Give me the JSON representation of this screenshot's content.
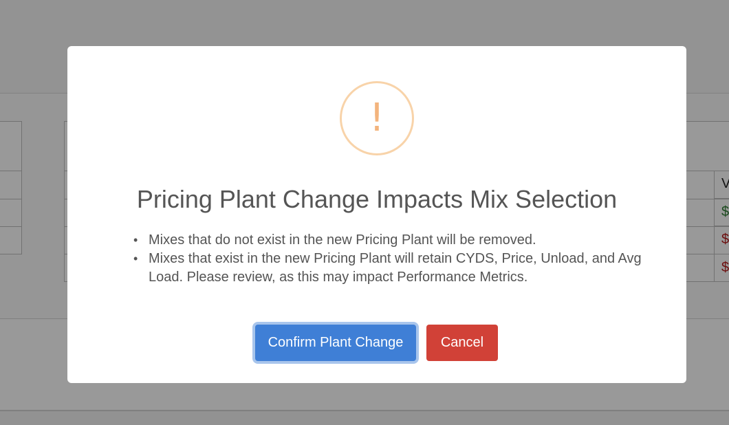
{
  "background": {
    "last_column": {
      "header": "V",
      "cells": [
        {
          "text": "$",
          "tone": "green"
        },
        {
          "text": "$",
          "tone": "red"
        },
        {
          "text": "$",
          "tone": "red"
        }
      ]
    }
  },
  "modal": {
    "icon": "exclamation-warning-icon",
    "icon_glyph": "!",
    "title": "Pricing Plant Change Impacts Mix Selection",
    "bullets": [
      "Mixes that do not exist in the new Pricing Plant will be removed.",
      "Mixes that exist in the new Pricing Plant will retain CYDS, Price, Unload, and Avg Load. Please review, as this may impact Performance Metrics."
    ],
    "confirm_label": "Confirm Plant Change",
    "cancel_label": "Cancel"
  },
  "colors": {
    "confirm": "#3f7fd6",
    "cancel": "#d14137",
    "warning": "#f3b47d"
  }
}
